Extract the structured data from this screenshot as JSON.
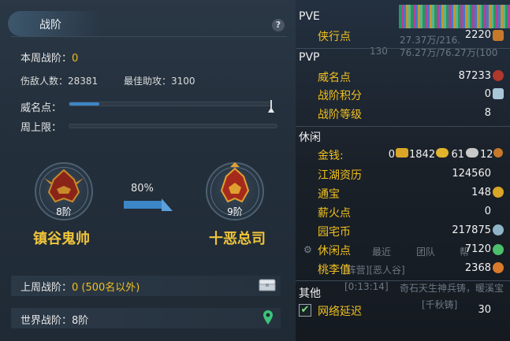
{
  "left": {
    "title": "战阶",
    "help": "?",
    "weekly_rank_label": "本周战阶：",
    "weekly_rank_value": "0",
    "enemies_label": "伤敌人数：",
    "enemies_value": "28381",
    "assists_label": "最佳助攻：",
    "assists_value": "3100",
    "prestige_label": "威名点：",
    "prestige_progress": 0.15,
    "weekly_cap_label": "周上限：",
    "weekly_cap_progress": 0,
    "current_rank": {
      "level": "8阶",
      "name": "镇谷鬼帅"
    },
    "next_rank": {
      "level": "9阶",
      "name": "十恶总司"
    },
    "progress_percent": "80%",
    "last_week_label": "上周战阶：",
    "last_week_value": "0 (500名以外)",
    "world_rank_label": "世界战阶：",
    "world_rank_value": "8阶"
  },
  "right": {
    "pve_title": "PVE",
    "pve_items": [
      {
        "label": "侠行点",
        "value": "2220"
      }
    ],
    "pvp_title": "PVP",
    "pvp_items": [
      {
        "label": "威名点",
        "value": "87233"
      },
      {
        "label": "战阶积分",
        "value": "0"
      },
      {
        "label": "战阶等级",
        "value": "8"
      }
    ],
    "leisure_title": "休闲",
    "money_label": "金钱:",
    "money_values": [
      "0",
      "1842",
      "61",
      "12"
    ],
    "leisure_items": [
      {
        "label": "江湖资历",
        "value": "124560"
      },
      {
        "label": "通宝",
        "value": "148"
      },
      {
        "label": "薪火点",
        "value": "0"
      },
      {
        "label": "园宅币",
        "value": "217875"
      },
      {
        "label": "休闲点",
        "value": "7120"
      },
      {
        "label": "桃李值",
        "value": "2368"
      }
    ],
    "other_title": "其他",
    "other_items": [
      {
        "label": "网络延迟",
        "value": "30",
        "checked": true
      }
    ],
    "bg_fragments": {
      "tab_recent": "最近",
      "tab_team": "团队",
      "tab_gang": "帮",
      "chat_line_1": "[阵营][恶人谷]",
      "chat_line_2": "[0:13:14]",
      "chat_line_3": "奇石天生神兵铸，暖溪宝",
      "chat_line_4": "[千秋铸]",
      "top_left_num": "130",
      "top_values_1": "27.37万/216.",
      "top_values_2": "76.27万/76.27万(100"
    }
  },
  "colors": {
    "gold": "#f0c020",
    "bar_blue": "#3d86c8",
    "rank_gold": "#f0c43a"
  }
}
